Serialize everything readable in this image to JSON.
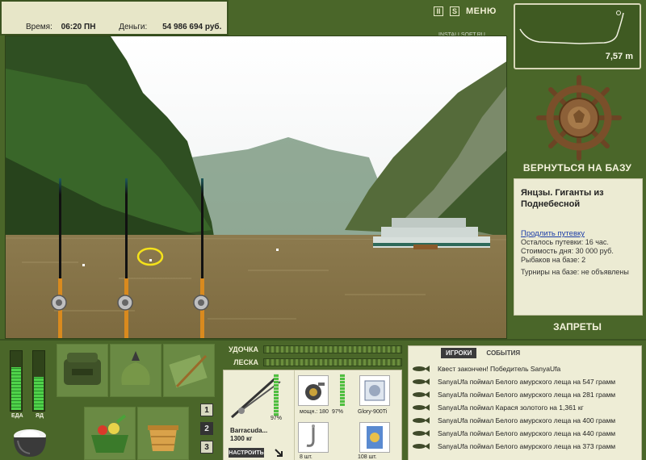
{
  "status": {
    "time_label": "Время:",
    "time_value": "06:20 ПН",
    "money_label": "Деньги:",
    "money_value": "54 986 694 руб."
  },
  "header": {
    "pause_glyph": "II",
    "sound_glyph": "S",
    "menu_label": "МЕНЮ",
    "watermark": "INSTALLSOFT.RU"
  },
  "depth": {
    "value": "7,57 m"
  },
  "right": {
    "return_label": "ВЕРНУТЬСЯ НА БАЗУ",
    "location_title": "Янцзы. Гиганты из Поднебесной",
    "extend_link": "Продлить путевку",
    "remaining": "Осталось путевки: 16 час.",
    "cost": "Стоимость дня: 30 000 руб.",
    "anglers": "Рыбаков на базе: 2",
    "tournaments": "Турниры на базе: не объявлены",
    "bans_label": "ЗАПРЕТЫ"
  },
  "gauges": {
    "food_label": "ЕДА",
    "poison_label": "ЯД",
    "food_level": 0.72,
    "poison_level": 0.55
  },
  "pages": [
    "1",
    "2",
    "3"
  ],
  "active_page": 1,
  "meters": {
    "rod_label": "УДОЧКА",
    "line_label": "ЛЕСКА"
  },
  "tackle": {
    "rod_name": "Barracuda...",
    "rod_weight": "1300 кг",
    "rod_pct": "97%",
    "setup_button": "НАСТРОИТЬ",
    "reel_label": "мощн.: 180",
    "reel_pct": "97%",
    "line_name": "Glory-900Ti",
    "hook_count": "8 шт.",
    "bait_count": "108 шт."
  },
  "chat": {
    "tab_players": "ИГРОКИ",
    "tab_events": "СОБЫТИЯ",
    "messages": [
      "Квест закончен! Победитель SanyaUfa",
      "SanyaUfa поймал Белого амурского леща на 547 грамм",
      "SanyaUfa поймал Белого амурского леща на 281 грамм",
      "SanyaUfa поймал Карася золотого на 1,361 кг",
      "SanyaUfa поймал Белого амурского леща на 400 грамм",
      "SanyaUfa поймал Белого амурского леща на 440 грамм",
      "SanyaUfa поймал Белого амурского леща на 373 грамм"
    ]
  },
  "colors": {
    "panel_bg": "#4a6629",
    "info_bg": "#ecebd3",
    "water": "#86754a",
    "highlight": "#f5e21a"
  }
}
